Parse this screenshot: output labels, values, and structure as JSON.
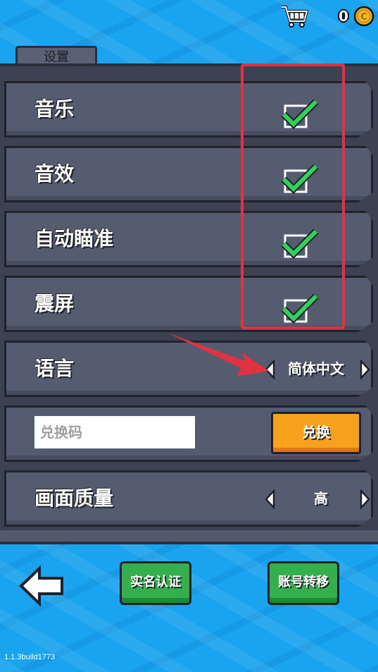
{
  "topbar": {
    "coin_count": "0"
  },
  "tab": {
    "title": "设置"
  },
  "toggles": [
    {
      "label": "音乐",
      "checked": true
    },
    {
      "label": "音效",
      "checked": true
    },
    {
      "label": "自动瞄准",
      "checked": true
    },
    {
      "label": "震屏",
      "checked": true
    }
  ],
  "language": {
    "label": "语言",
    "value": "简体中文"
  },
  "redeem": {
    "placeholder": "兑换码",
    "button_label": "兑换"
  },
  "quality": {
    "label": "画面质量",
    "value": "高"
  },
  "footer": {
    "realname_label": "实名认证",
    "transfer_label": "账号转移",
    "version": "1.1.3build1773"
  },
  "colors": {
    "accent_check": "#2fd35a",
    "highlight_red": "#e23140",
    "redeem_orange": "#f7a11d",
    "button_green": "#33b04c"
  }
}
